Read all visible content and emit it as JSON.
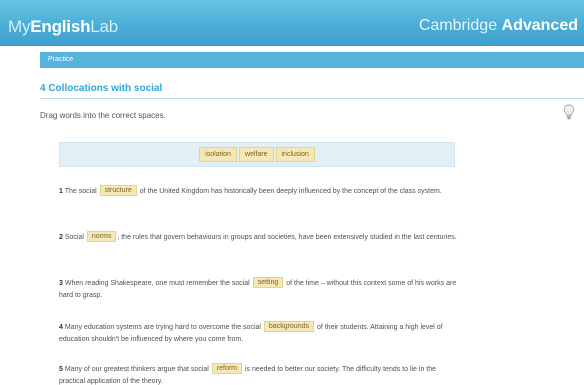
{
  "header": {
    "brand_part1": "My",
    "brand_part2": "English",
    "brand_part3": "Lab",
    "course_part1": "Cambridge ",
    "course_part2": "Advanced"
  },
  "breadcrumb": "Practice",
  "exercise": {
    "title": "4 Collocations with social",
    "instructions": "Drag words into the correct spaces."
  },
  "word_bank": [
    "isolation",
    "welfare",
    "inclusion"
  ],
  "questions": [
    {
      "number": "1",
      "before": "The social",
      "answer": "structure",
      "after": "of the United Kingdom has historically been deeply influenced by the concept of the class system."
    },
    {
      "number": "2",
      "before": "Social",
      "answer": "norms",
      "after": ", the rules that govern behaviours in groups and societies, have been extensively studied in the last centuries."
    },
    {
      "number": "3",
      "before": "When reading Shakespeare, one must remember the social",
      "answer": "setting",
      "after": "of the time – without this context some of his works are hard to grasp."
    },
    {
      "number": "4",
      "before": "Many education systems are trying hard to overcome the social",
      "answer": "backgrounds",
      "after": "of their students. Attaining a high level of education shouldn't be influenced by where you come from."
    },
    {
      "number": "5",
      "before": "Many of our greatest thinkers argue that social",
      "answer": "reform",
      "after": "is needed to better our society. The difficulty tends to lie in the practical application of the theory."
    }
  ],
  "colors": {
    "accent": "#2ea7d9",
    "header": "#49acd6",
    "tile": "#f5e8b6"
  },
  "icons": {
    "hint": "lightbulb-icon"
  }
}
